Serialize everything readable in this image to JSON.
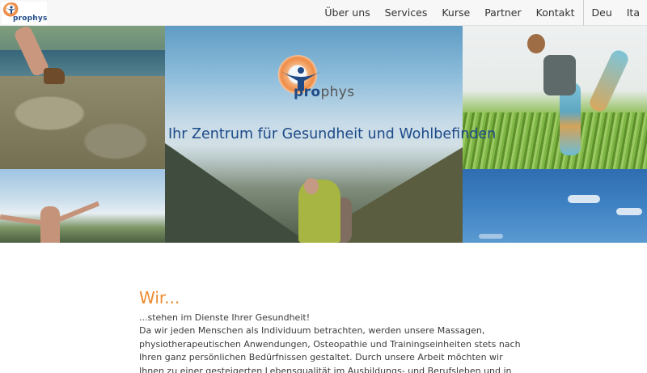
{
  "nav": {
    "logo_text": "prophys",
    "menu": [
      {
        "label": "Über uns"
      },
      {
        "label": "Services"
      },
      {
        "label": "Kurse"
      },
      {
        "label": "Partner"
      },
      {
        "label": "Kontakt"
      }
    ],
    "languages": [
      {
        "label": "Deu"
      },
      {
        "label": "Ita"
      }
    ]
  },
  "hero": {
    "logo_text_bold": "pro",
    "logo_text_light": "phys",
    "tagline": "Ihr Zentrum für Gesundheit und Wohlbefinden"
  },
  "intro": {
    "heading": "Wir...",
    "lead": "...stehen im Dienste Ihrer Gesundheit!",
    "body": "Da wir jeden Menschen als Individuum betrachten, werden unsere Massagen, physiotherapeutischen Anwendungen, Osteopathie und Trainingseinheiten stets nach Ihren ganz persönlichen Bedürfnissen gestaltet. Durch unsere Arbeit möchten wir Ihnen zu einer gesteigerten Lebensqualität im Ausbildungs- und Berufsleben und in Ihrer Freizeit verhelfen."
  },
  "colors": {
    "accent_orange": "#ee8a2f",
    "brand_blue": "#1c4a88"
  }
}
